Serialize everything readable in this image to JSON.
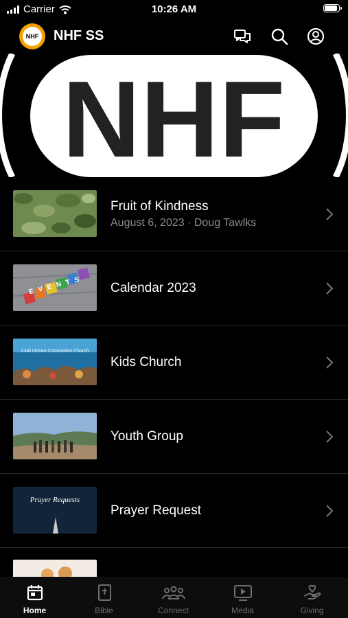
{
  "status_bar": {
    "carrier": "Carrier",
    "time": "10:26 AM",
    "battery_level": 1.0
  },
  "app_bar": {
    "logo_text": "NHF",
    "title": "NHF SS",
    "icons": [
      "chat-icon",
      "search-icon",
      "profile-icon"
    ]
  },
  "banner": {
    "text": "NHF"
  },
  "items": [
    {
      "title": "Fruit of Kindness",
      "subtitle": "August 6, 2023 · Doug Tawlks",
      "thumb": "leaves"
    },
    {
      "title": "Calendar 2023",
      "subtitle": "",
      "thumb": "events-blocks",
      "thumb_text": "EVENTS"
    },
    {
      "title": "Kids Church",
      "subtitle": "",
      "thumb": "ocean",
      "thumb_text": "Club Ocean Commotion Church"
    },
    {
      "title": "Youth Group",
      "subtitle": "",
      "thumb": "hikers"
    },
    {
      "title": "Prayer Request",
      "subtitle": "",
      "thumb": "prayer",
      "thumb_text": "Prayer Requests"
    }
  ],
  "tabs": [
    {
      "label": "Home",
      "icon": "calendar-icon",
      "active": true
    },
    {
      "label": "Bible",
      "icon": "bible-icon",
      "active": false
    },
    {
      "label": "Connect",
      "icon": "people-icon",
      "active": false
    },
    {
      "label": "Media",
      "icon": "play-icon",
      "active": false
    },
    {
      "label": "Giving",
      "icon": "giving-hand-icon",
      "active": false
    }
  ]
}
